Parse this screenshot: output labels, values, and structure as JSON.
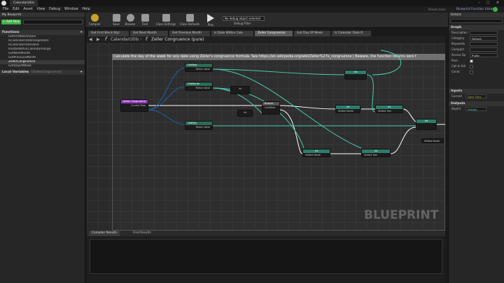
{
  "window": {
    "tab_title": "CalendarUtils",
    "right_label": "Parent class:",
    "parent_class": "Blueprint Function Library"
  },
  "menu": [
    "File",
    "Edit",
    "Asset",
    "View",
    "Debug",
    "Window",
    "Help"
  ],
  "toolbar": {
    "buttons": [
      "Compile",
      "Save",
      "Browse",
      "Find",
      "Class Settings",
      "Class Defaults",
      "Play"
    ],
    "debug_filter_value": "No debug object selected",
    "debug_filter_label": "Debug Filter"
  },
  "left_panel": {
    "my_blueprint_tab": "My Blueprint",
    "add_new": "+ Add New",
    "search_placeholder": "Search",
    "functions_header": "Functions",
    "functions": [
      "GetFirstBlockStyle",
      "IsCalendarDateRangeValid",
      "IsCalendarDateValid",
      "IsDateWithinCalendarRange",
      "GetNextMonth",
      "GetPreviousMonth",
      "ZellerCongruence",
      "GetDayOfWeek"
    ],
    "selected_function": "ZellerCongruence",
    "local_vars_header": "Local Variables",
    "local_vars_scope": "(ZellerCongruence)"
  },
  "doc_tabs": [
    {
      "label": "Get First Block Styl",
      "active": false
    },
    {
      "label": "Get Next Month",
      "active": false
    },
    {
      "label": "Get Previous Month",
      "active": false
    },
    {
      "label": "Is Date Within Cale",
      "active": false
    },
    {
      "label": "Zeller Congruence",
      "active": true
    },
    {
      "label": "Get Day Of Week",
      "active": false
    },
    {
      "label": "Is Calendar Date R",
      "active": false
    }
  ],
  "breadcrumb": {
    "root": "CalendarUtils",
    "current": "Zeller Congruence (pure)"
  },
  "graph": {
    "comment": "Calculate the day of the week for any date using Zeller's congruence formula. See https://en.wikipedia.org/wiki/Zeller%27s_congruence | Beware, the function returns zero f",
    "watermark": "BLUEPRINT",
    "entry_node": {
      "title": "Zeller Congruence",
      "pin": "Current Time"
    },
    "break_nodes": [
      "GetYear",
      "GetMonth",
      "GetDay"
    ],
    "return_pin": "Return Value",
    "branch_node": {
      "title": "Branch",
      "pins": [
        "Condition",
        "True",
        "False"
      ]
    },
    "mod_nodes": [
      "Int Mod Int",
      "Int Mod Int"
    ],
    "int_labels": [
      "int",
      "int",
      "int",
      "int",
      "int",
      "int",
      "int"
    ],
    "misc_labels": [
      "Shifted Month",
      "Shifted Year",
      "Shifted Month",
      "Shifted Year",
      "Shifted Month"
    ]
  },
  "bottom_panel": {
    "tabs": [
      "Compiler Results",
      "Find Results"
    ]
  },
  "right_panel": {
    "details_tab": "Details",
    "search_placeholder": "Search Details",
    "graph_header": "Graph",
    "props": [
      {
        "name": "Description",
        "value": ""
      },
      {
        "name": "Category",
        "value": "Default"
      },
      {
        "name": "Keywords",
        "value": ""
      },
      {
        "name": "Compact",
        "value": ""
      },
      {
        "name": "Access Sp",
        "value": "Public"
      }
    ],
    "checks": [
      {
        "name": "Pure",
        "checked": true
      },
      {
        "name": "Call In Edi",
        "checked": false
      },
      {
        "name": "Const",
        "checked": false
      }
    ],
    "inputs_header": "Inputs",
    "input": {
      "name": "Current",
      "type": "Date Time"
    },
    "outputs_header": "Outputs",
    "output": {
      "name": "DayInt",
      "type": "Integer"
    }
  },
  "colors": {
    "bg": "#1a1a1a",
    "accent": "#3fae49",
    "exec": "#ffffff",
    "wire_int": "#47d0b4",
    "wire_struct": "#1f5ea8"
  }
}
